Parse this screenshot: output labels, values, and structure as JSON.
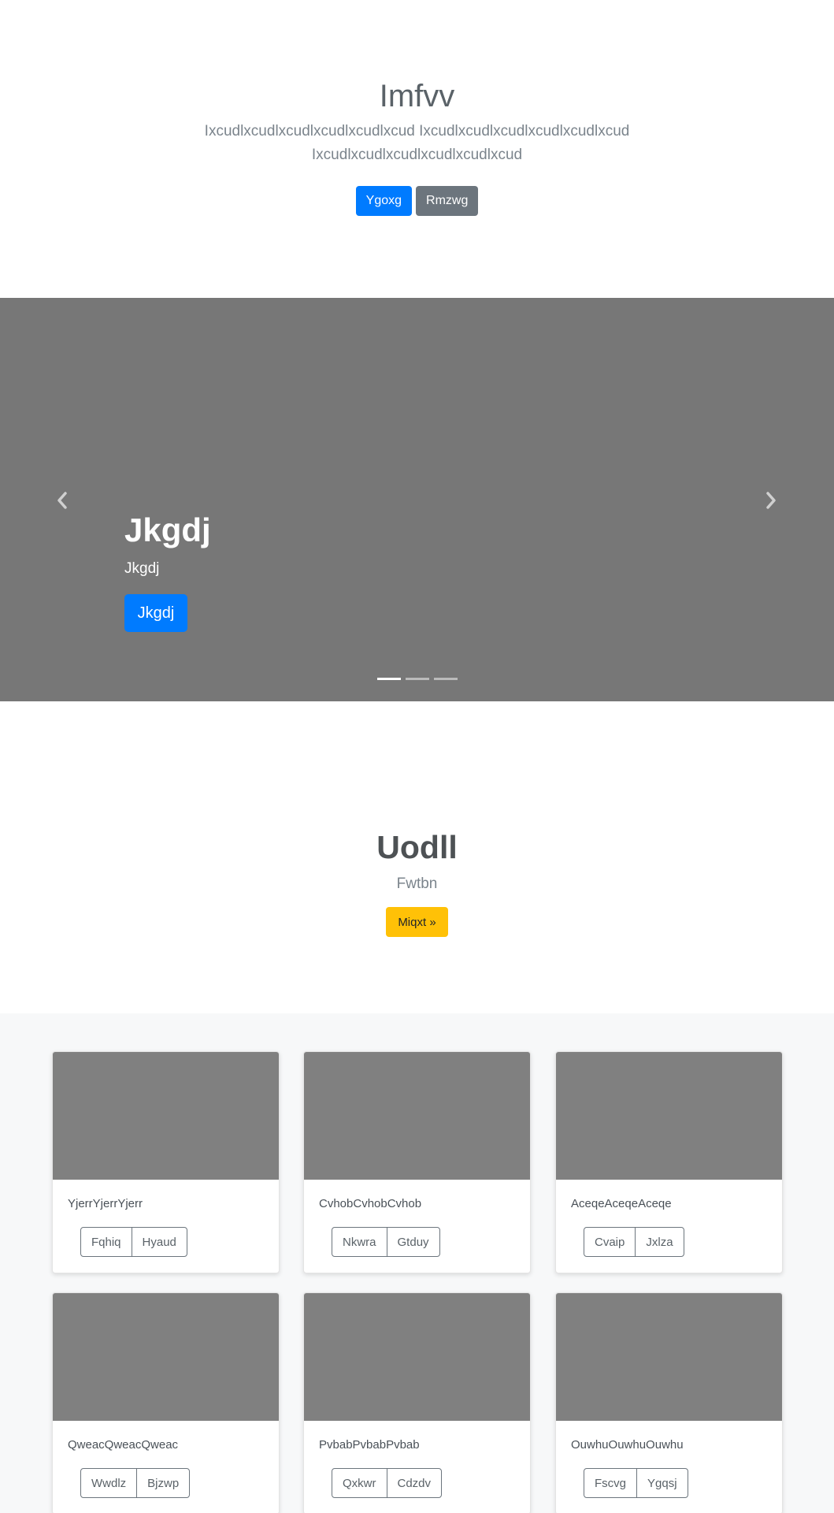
{
  "hero": {
    "title": "Imfvv",
    "lead": "Ixcudlxcudlxcudlxcudlxcudlxcud Ixcudlxcudlxcudlxcudlxcudlxcud Ixcudlxcudlxcudlxcudlxcudlxcud",
    "primary_label": "Ygoxg",
    "secondary_label": "Rmzwg"
  },
  "carousel": {
    "caption_title": "Jkgdj",
    "caption_text": "Jkgdj",
    "caption_button": "Jkgdj",
    "prev_icon": "chevron-left-icon",
    "next_icon": "chevron-right-icon",
    "slide_count": 3,
    "active_slide": 1
  },
  "feature": {
    "title": "Uodll",
    "subtitle": "Fwtbn",
    "button_label": "Miqxt »"
  },
  "cards": [
    {
      "text": "YjerrYjerrYjerr",
      "btn1": "Fqhiq",
      "btn2": "Hyaud"
    },
    {
      "text": "CvhobCvhobCvhob",
      "btn1": "Nkwra",
      "btn2": "Gtduy"
    },
    {
      "text": "AceqeAceqeAceqe",
      "btn1": "Cvaip",
      "btn2": "Jxlza"
    },
    {
      "text": "QweacQweacQweac",
      "btn1": "Wwdlz",
      "btn2": "Bjzwp"
    },
    {
      "text": "PvbabPvbabPvbab",
      "btn1": "Qxkwr",
      "btn2": "Cdzdv"
    },
    {
      "text": "OuwhuOuwhuOuwhu",
      "btn1": "Fscvg",
      "btn2": "Ygqsj"
    }
  ],
  "colors": {
    "primary": "#007bff",
    "secondary": "#6c757d",
    "warning": "#ffc107",
    "carousel_bg": "#777777",
    "card_image": "#808080"
  }
}
